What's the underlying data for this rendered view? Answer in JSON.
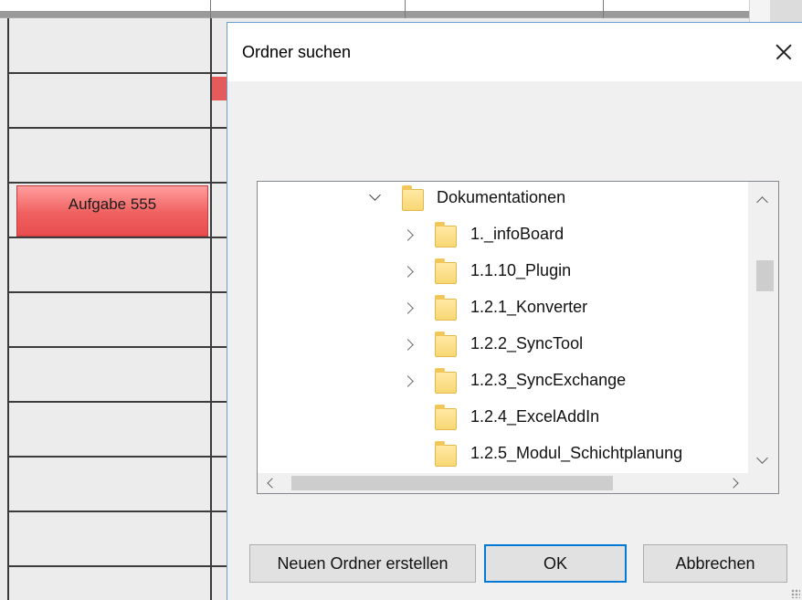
{
  "background": {
    "task_label": "Aufgabe 555",
    "task_color": "#f06060"
  },
  "dialog": {
    "title": "Ordner suchen",
    "tree": {
      "root": {
        "label": "Dokumentationen",
        "expanded": true
      },
      "children": [
        {
          "label": "1._infoBoard",
          "has_children": true
        },
        {
          "label": "1.1.10_Plugin",
          "has_children": true
        },
        {
          "label": "1.2.1_Konverter",
          "has_children": true
        },
        {
          "label": "1.2.2_SyncTool",
          "has_children": true
        },
        {
          "label": "1.2.3_SyncExchange",
          "has_children": true
        },
        {
          "label": "1.2.4_ExcelAddIn",
          "has_children": false
        },
        {
          "label": "1.2.5_Modul_Schichtplanung",
          "has_children": false
        }
      ]
    },
    "buttons": {
      "new_folder": "Neuen Ordner erstellen",
      "ok": "OK",
      "cancel": "Abbrechen"
    },
    "accent_color": "#0078d7"
  }
}
